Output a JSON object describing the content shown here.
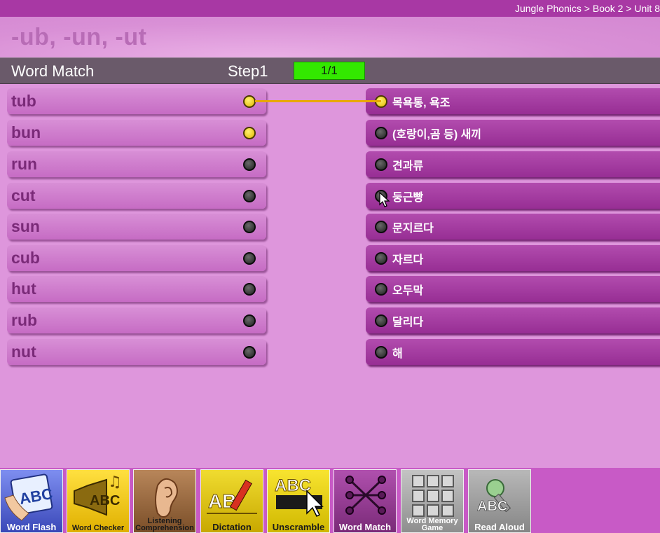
{
  "breadcrumb": "Jungle Phonics > Book 2 > Unit 8",
  "title": "-ub, -un, -ut",
  "activity": "Word Match",
  "step": "Step1",
  "progress": "1/1",
  "words": [
    "tub",
    "bun",
    "run",
    "cut",
    "sun",
    "cub",
    "hut",
    "rub",
    "nut"
  ],
  "meanings": [
    "목욕통, 욕조",
    "(호랑이,곰 등) 새끼",
    "견과류",
    "둥근빵",
    "문지르다",
    "자르다",
    "오두막",
    "달리다",
    "해"
  ],
  "selected_word_dots": [
    "tub",
    "bun"
  ],
  "connected_pair": {
    "word": "tub",
    "meaning": "목욕통, 욕조"
  },
  "tabs": [
    {
      "label": "Word Flash",
      "icon": "word-flash-icon",
      "bg": "#5a6ad8"
    },
    {
      "label": "Word Checker",
      "icon": "word-checker-icon",
      "bg": "#e8c400"
    },
    {
      "label": "Listening Comprehension",
      "icon": "ear-icon",
      "bg": "#9a6a3a"
    },
    {
      "label": "Dictation",
      "icon": "pencil-abc-icon",
      "bg": "#d8c000"
    },
    {
      "label": "Unscramble",
      "icon": "unscramble-icon",
      "bg": "#d8c800"
    },
    {
      "label": "Word  Match",
      "icon": "word-match-icon",
      "bg": "#9a3a98"
    },
    {
      "label": "Word Memory Game",
      "icon": "memory-grid-icon",
      "bg": "#a8a8a8"
    },
    {
      "label": "Read Aloud",
      "icon": "microphone-icon",
      "bg": "#9a9a9a"
    }
  ],
  "colors": {
    "accent": "#a838a4",
    "progress": "#33e800",
    "selected_dot": "#f5d800"
  }
}
